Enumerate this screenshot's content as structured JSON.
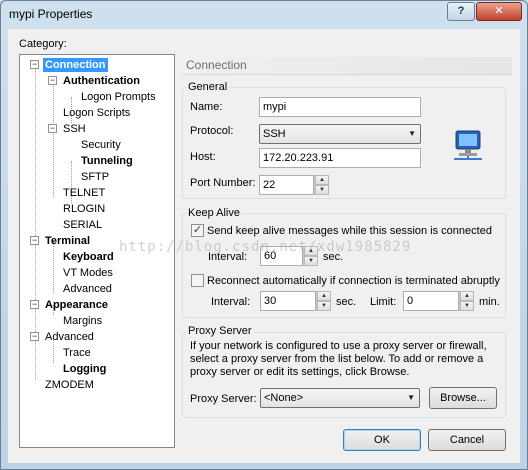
{
  "window": {
    "title": "mypi Properties",
    "help_glyph": "?",
    "close_glyph": "✕"
  },
  "category_label": "Category:",
  "tree": {
    "items": [
      {
        "label": "Connection"
      },
      {
        "label": "Authentication"
      },
      {
        "label": "Logon Prompts"
      },
      {
        "label": "Logon Scripts"
      },
      {
        "label": "SSH"
      },
      {
        "label": "Security"
      },
      {
        "label": "Tunneling"
      },
      {
        "label": "SFTP"
      },
      {
        "label": "TELNET"
      },
      {
        "label": "RLOGIN"
      },
      {
        "label": "SERIAL"
      },
      {
        "label": "Terminal"
      },
      {
        "label": "Keyboard"
      },
      {
        "label": "VT Modes"
      },
      {
        "label": "Advanced"
      },
      {
        "label": "Appearance"
      },
      {
        "label": "Margins"
      },
      {
        "label": "Advanced"
      },
      {
        "label": "Trace"
      },
      {
        "label": "Logging"
      },
      {
        "label": "ZMODEM"
      }
    ],
    "selected": "Connection",
    "expander_symbol": "−"
  },
  "panel": {
    "header": "Connection",
    "general": {
      "title": "General",
      "name_label": "Name:",
      "name_value": "mypi",
      "protocol_label": "Protocol:",
      "protocol_value": "SSH",
      "host_label": "Host:",
      "host_value": "172.20.223.91",
      "port_label": "Port Number:",
      "port_value": "22"
    },
    "keepalive": {
      "title": "Keep Alive",
      "send_label": "Send keep alive messages while this session is connected",
      "send_checked": true,
      "interval_label": "Interval:",
      "interval_value": "60",
      "sec_label": "sec.",
      "reconnect_label": "Reconnect automatically if connection is terminated abruptly",
      "reconnect_checked": false,
      "interval2_label": "Interval:",
      "interval2_value": "30",
      "sec2_label": "sec.",
      "limit_label": "Limit:",
      "limit_value": "0",
      "min_label": "min."
    },
    "proxy": {
      "title": "Proxy Server",
      "description": "If your network is configured to use a proxy server or firewall, select a proxy server from the list below. To add or remove a proxy server or edit its settings, click Browse.",
      "server_label": "Proxy Server:",
      "server_value": "<None>",
      "browse_label": "Browse..."
    }
  },
  "buttons": {
    "ok": "OK",
    "cancel": "Cancel"
  },
  "watermark": "http://blog.csdn.net/xdw1985829",
  "check_glyph": "✓",
  "icons": {
    "computer": "network-computer-icon"
  }
}
